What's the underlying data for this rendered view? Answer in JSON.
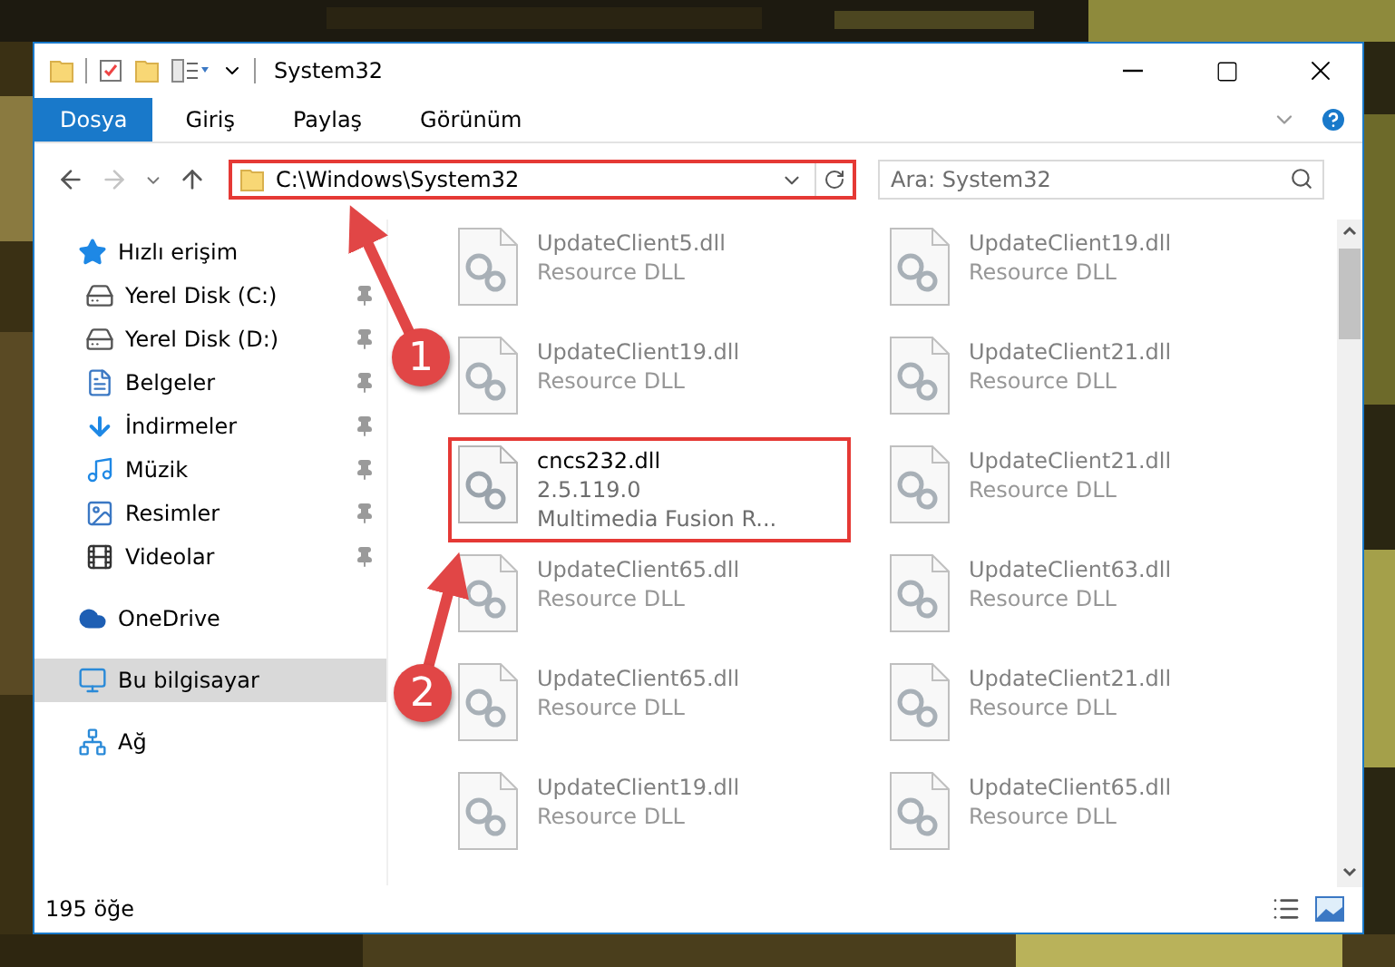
{
  "window": {
    "title": "System32"
  },
  "ribbon_tabs": [
    {
      "label": "Dosya",
      "selected": true
    },
    {
      "label": "Giriş",
      "selected": false
    },
    {
      "label": "Paylaş",
      "selected": false
    },
    {
      "label": "Görünüm",
      "selected": false
    }
  ],
  "address": {
    "path": "C:\\Windows\\System32",
    "highlighted": true
  },
  "search": {
    "placeholder": "Ara: System32"
  },
  "sidebar": {
    "items": [
      {
        "label": "Hızlı erişim",
        "kind": "quick",
        "selected": false,
        "children": [
          {
            "label": "Yerel Disk (C:)",
            "kind": "system-drive",
            "pinned": true,
            "selected": false
          },
          {
            "label": "Yerel Disk (D:)",
            "kind": "drive",
            "pinned": true,
            "selected": false
          },
          {
            "label": "Belgeler",
            "kind": "documents",
            "pinned": true,
            "selected": false
          },
          {
            "label": "İndirmeler",
            "kind": "downloads",
            "pinned": true,
            "selected": false
          },
          {
            "label": "Müzik",
            "kind": "music",
            "pinned": true,
            "selected": false
          },
          {
            "label": "Resimler",
            "kind": "pictures",
            "pinned": true,
            "selected": false
          },
          {
            "label": "Videolar",
            "kind": "videos",
            "pinned": true,
            "selected": false
          }
        ]
      },
      {
        "label": "OneDrive",
        "kind": "cloud",
        "selected": false
      },
      {
        "label": "Bu bilgisayar",
        "kind": "computer",
        "selected": true
      },
      {
        "label": "Ağ",
        "kind": "network",
        "selected": false
      }
    ]
  },
  "files": [
    {
      "name": "UpdateClient5.dll",
      "details": [
        "Resource DLL"
      ],
      "blurred": true,
      "highlighted": false
    },
    {
      "name": "UpdateClient19.dll",
      "details": [
        "Resource DLL"
      ],
      "blurred": true,
      "highlighted": false
    },
    {
      "name": "UpdateClient19.dll",
      "details": [
        "Resource DLL"
      ],
      "blurred": true,
      "highlighted": false
    },
    {
      "name": "UpdateClient21.dll",
      "details": [
        "Resource DLL"
      ],
      "blurred": true,
      "highlighted": false
    },
    {
      "name": "cncs232.dll",
      "details": [
        "2.5.119.0",
        "Multimedia Fusion R..."
      ],
      "blurred": false,
      "highlighted": true
    },
    {
      "name": "UpdateClient21.dll",
      "details": [
        "Resource DLL"
      ],
      "blurred": true,
      "highlighted": false
    },
    {
      "name": "UpdateClient65.dll",
      "details": [
        "Resource DLL"
      ],
      "blurred": true,
      "highlighted": false
    },
    {
      "name": "UpdateClient63.dll",
      "details": [
        "Resource DLL"
      ],
      "blurred": true,
      "highlighted": false
    },
    {
      "name": "UpdateClient65.dll",
      "details": [
        "Resource DLL"
      ],
      "blurred": true,
      "highlighted": false
    },
    {
      "name": "UpdateClient21.dll",
      "details": [
        "Resource DLL"
      ],
      "blurred": true,
      "highlighted": false
    },
    {
      "name": "UpdateClient19.dll",
      "details": [
        "Resource DLL"
      ],
      "blurred": true,
      "highlighted": false
    },
    {
      "name": "UpdateClient65.dll",
      "details": [
        "Resource DLL"
      ],
      "blurred": true,
      "highlighted": false
    }
  ],
  "status_bar": {
    "count": "195 öğe"
  },
  "callouts": [
    {
      "number": "1"
    },
    {
      "number": "2"
    }
  ]
}
